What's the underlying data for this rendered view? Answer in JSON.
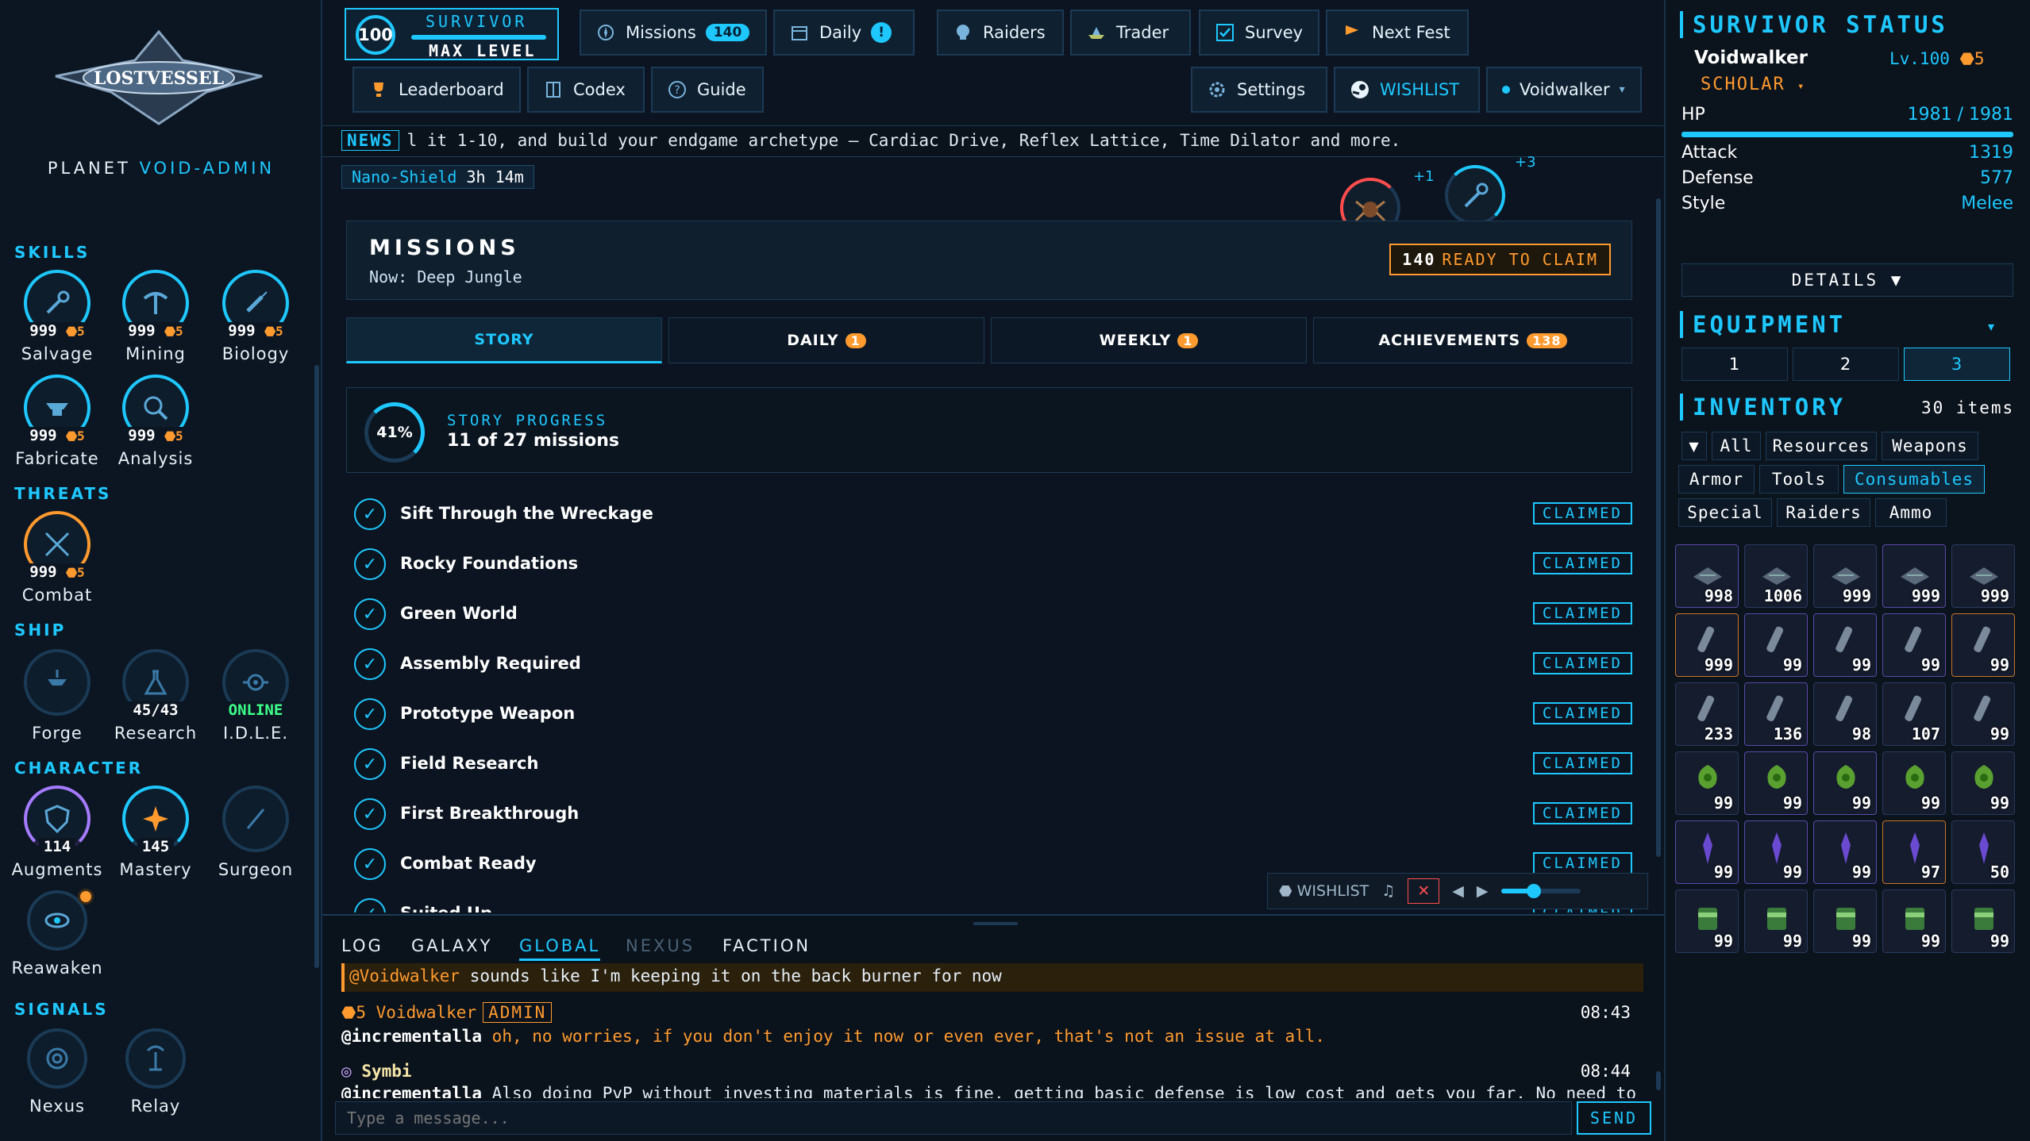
{
  "sidebar": {
    "logo_text": "LOSTVESSEL",
    "planet_label": "PLANET",
    "planet_name": "VOID-ADMIN",
    "sections": {
      "skills": "SKILLS",
      "threats": "THREATS",
      "ship": "SHIP",
      "character": "CHARACTER",
      "signals": "SIGNALS"
    },
    "skills": [
      {
        "count": "999",
        "badge": "5",
        "label": "Salvage"
      },
      {
        "count": "999",
        "badge": "5",
        "label": "Mining"
      },
      {
        "count": "999",
        "badge": "5",
        "label": "Biology"
      },
      {
        "count": "999",
        "badge": "5",
        "label": "Fabricate"
      },
      {
        "count": "999",
        "badge": "5",
        "label": "Analysis"
      }
    ],
    "threats": [
      {
        "count": "999",
        "badge": "5",
        "label": "Combat"
      }
    ],
    "ship": [
      {
        "label": "Forge"
      },
      {
        "count": "45/43",
        "label": "Research"
      },
      {
        "count": "ONLINE",
        "label": "I.D.L.E."
      }
    ],
    "character": [
      {
        "count": "114",
        "label": "Augments"
      },
      {
        "count": "145",
        "label": "Mastery"
      },
      {
        "label": "Surgeon"
      },
      {
        "label": "Reawaken"
      }
    ],
    "signals": [
      {
        "label": "Nexus"
      },
      {
        "label": "Relay"
      }
    ]
  },
  "level": {
    "value": "100",
    "line1": "SURVIVOR",
    "line2": "MAX LEVEL"
  },
  "topnav": {
    "missions": "Missions",
    "missions_count": "140",
    "daily": "Daily",
    "daily_badge": "!",
    "raiders": "Raiders",
    "trader": "Trader",
    "survey": "Survey",
    "nextfest": "Next Fest",
    "leaderboard": "Leaderboard",
    "codex": "Codex",
    "guide": "Guide",
    "settings": "Settings",
    "wishlist": "WISHLIST",
    "user": "Voidwalker"
  },
  "news": {
    "tag": "NEWS",
    "text": "l it 1-10, and build your endgame archetype – Cardiac Drive, Reflex Lattice, Time Dilator and more."
  },
  "buff": {
    "name": "Nano-Shield",
    "time": "3h 14m"
  },
  "orbs": [
    {
      "plus": "+1"
    },
    {
      "plus": "+3"
    }
  ],
  "missions": {
    "title": "MISSIONS",
    "now": "Now: Deep Jungle",
    "claim_count": "140",
    "claim_label": "READY TO CLAIM",
    "tabs": [
      {
        "label": "STORY",
        "badge": ""
      },
      {
        "label": "DAILY",
        "badge": "1"
      },
      {
        "label": "WEEKLY",
        "badge": "1"
      },
      {
        "label": "ACHIEVEMENTS",
        "badge": "138"
      }
    ],
    "progress": {
      "percent": "41%",
      "label": "STORY PROGRESS",
      "summary": "11 of 27 missions"
    },
    "claimed_label": "CLAIMED",
    "list": [
      "Sift Through the Wreckage",
      "Rocky Foundations",
      "Green World",
      "Assembly Required",
      "Prototype Weapon",
      "Field Research",
      "First Breakthrough",
      "Combat Ready",
      "Suited Up"
    ]
  },
  "player": {
    "wishlist": "WISHLIST",
    "volume": 0.4
  },
  "chat": {
    "tabs": [
      "LOG",
      "GALAXY",
      "GLOBAL",
      "NEXUS",
      "FACTION"
    ],
    "messages": [
      {
        "mention": "@Voidwalker",
        "text": "sounds like I'm keeping it on the back burner for now"
      },
      {
        "user": "Voidwalker",
        "level": "5",
        "role": "ADMIN",
        "time": "08:43",
        "mention": "@incrementalla",
        "text": "oh, no worries, if you don't enjoy it now or even ever, that's not an issue at all."
      },
      {
        "user": "Symbi",
        "time": "08:44",
        "mention": "@incrementalla",
        "text": "Also doing PvP without investing materials is fine, getting basic defense is low cost and gets you far. No need to"
      }
    ],
    "placeholder": "Type a message...",
    "send": "SEND"
  },
  "status": {
    "title": "SURVIVOR STATUS",
    "name": "Voidwalker",
    "level": "Lv.100",
    "level_badge": "5",
    "class": "SCHOLAR",
    "hp_label": "HP",
    "hp": "1981 / 1981",
    "stats": [
      {
        "k": "Attack",
        "v": "1319"
      },
      {
        "k": "Defense",
        "v": "577"
      },
      {
        "k": "Style",
        "v": "Melee"
      }
    ],
    "details": "DETAILS ▼"
  },
  "equipment": {
    "title": "EQUIPMENT",
    "loadouts": [
      "1",
      "2",
      "3"
    ]
  },
  "inventory": {
    "title": "INVENTORY",
    "count": "30 items",
    "filters": [
      "All",
      "Resources",
      "Weapons",
      "Armor",
      "Tools",
      "Consumables",
      "Special",
      "Raiders",
      "Ammo"
    ],
    "items": [
      "998",
      "1006",
      "999",
      "999",
      "999",
      "999",
      "99",
      "99",
      "99",
      "99",
      "233",
      "136",
      "98",
      "107",
      "99",
      "99",
      "99",
      "99",
      "99",
      "99",
      "99",
      "99",
      "99",
      "97",
      "50",
      "99",
      "99",
      "99",
      "99",
      "99"
    ]
  },
  "colors": {
    "accent": "#1ec8ff",
    "warning": "#ff9a2e",
    "online": "#3dff8a",
    "bg": "#0b1420"
  }
}
